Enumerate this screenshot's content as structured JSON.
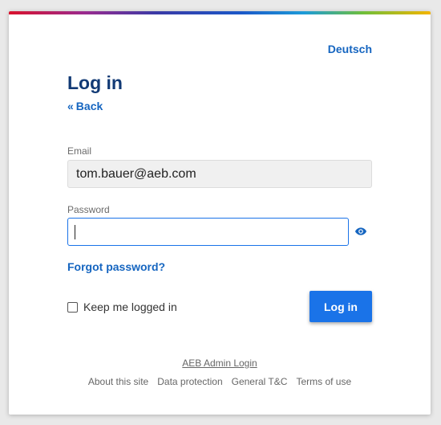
{
  "language_link": "Deutsch",
  "title": "Log in",
  "back": {
    "icon": "«",
    "label": "Back"
  },
  "email": {
    "label": "Email",
    "value": "tom.bauer@aeb.com"
  },
  "password": {
    "label": "Password",
    "value": ""
  },
  "forgot_password": "Forgot password?",
  "keep_logged_in": "Keep me logged in",
  "login_button": "Log in",
  "admin_login": "AEB Admin Login",
  "footer_links": [
    "About this site",
    "Data protection",
    "General T&C",
    "Terms of use"
  ],
  "colors": {
    "primary": "#1a73e8",
    "link": "#1565c0",
    "title": "#123a75"
  }
}
